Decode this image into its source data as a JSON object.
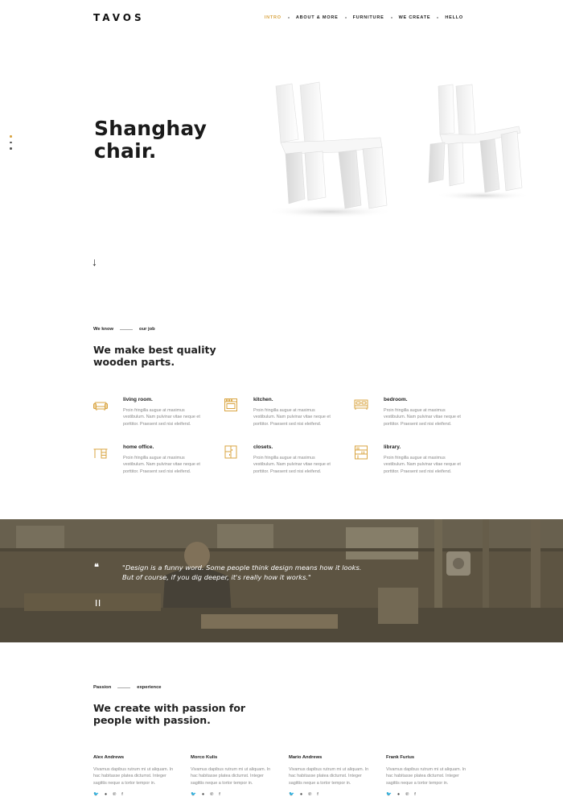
{
  "header": {
    "logo": "TAVOS",
    "nav": [
      {
        "label": "INTRO",
        "active": true
      },
      {
        "label": "ABOUT & MORE",
        "active": false
      },
      {
        "label": "FURNITURE",
        "active": false
      },
      {
        "label": "WE CREATE",
        "active": false
      },
      {
        "label": "HELLO",
        "active": false
      }
    ]
  },
  "hero": {
    "title": "Shanghay\nchair.",
    "scroll_arrow": "↓"
  },
  "about": {
    "eyebrow_left": "We know",
    "eyebrow_right": "our job",
    "title": "We make best quality\nwooden parts.",
    "features": [
      {
        "icon": "sofa-icon",
        "title": "living room.",
        "text": "Proin fringilla augue at maximus vestibulum. Nam pulvinar vitae neque et porttitor. Praesent sed nisi eleifend."
      },
      {
        "icon": "oven-icon",
        "title": "kitchen.",
        "text": "Proin fringilla augue at maximus vestibulum. Nam pulvinar vitae neque et porttitor. Praesent sed nisi eleifend."
      },
      {
        "icon": "bed-icon",
        "title": "bedroom.",
        "text": "Proin fringilla augue at maximus vestibulum. Nam pulvinar vitae neque et porttitor. Praesent sed nisi eleifend."
      },
      {
        "icon": "desk-icon",
        "title": "home office.",
        "text": "Proin fringilla augue at maximus vestibulum. Nam pulvinar vitae neque et porttitor. Praesent sed nisi eleifend."
      },
      {
        "icon": "closet-icon",
        "title": "closets.",
        "text": "Proin fringilla augue at maximus vestibulum. Nam pulvinar vitae neque et porttitor. Praesent sed nisi eleifend."
      },
      {
        "icon": "bookshelf-icon",
        "title": "library.",
        "text": "Proin fringilla augue at maximus vestibulum. Nam pulvinar vitae neque et porttitor. Praesent sed nisi eleifend."
      }
    ]
  },
  "quote": {
    "mark": "❝",
    "text": "\"Design is a funny word. Some people think design means how it looks.\nBut of course, if you dig deeper, it's really how it works.\""
  },
  "team": {
    "eyebrow_left": "Passion",
    "eyebrow_right": "experience",
    "title": "We create with passion for\npeople with passion.",
    "members": [
      {
        "name": "Alex Andrews",
        "text": "Vivamus dapibus rutrum mi ut aliquam. In hac habitasse platea dictumst. Integer sagittis neque a tortor tempor in."
      },
      {
        "name": "Morco Kulis",
        "text": "Vivamus dapibus rutrum mi ut aliquam. In hac habitasse platea dictumst. Integer sagittis neque a tortor tempor in."
      },
      {
        "name": "Mario Andrews",
        "text": "Vivamus dapibus rutrum mi ut aliquam. In hac habitasse platea dictumst. Integer sagittis neque a tortor tempor in."
      },
      {
        "name": "Frank Furius",
        "text": "Vivamus dapibus rutrum mi ut aliquam. In hac habitasse platea dictumst. Integer sagittis neque a tortor tempor in."
      }
    ],
    "social_icons": [
      "twitter-icon",
      "github-icon",
      "pinterest-icon",
      "facebook-icon"
    ]
  },
  "colors": {
    "accent": "#d9a441",
    "text": "#222222",
    "muted": "#888888"
  }
}
